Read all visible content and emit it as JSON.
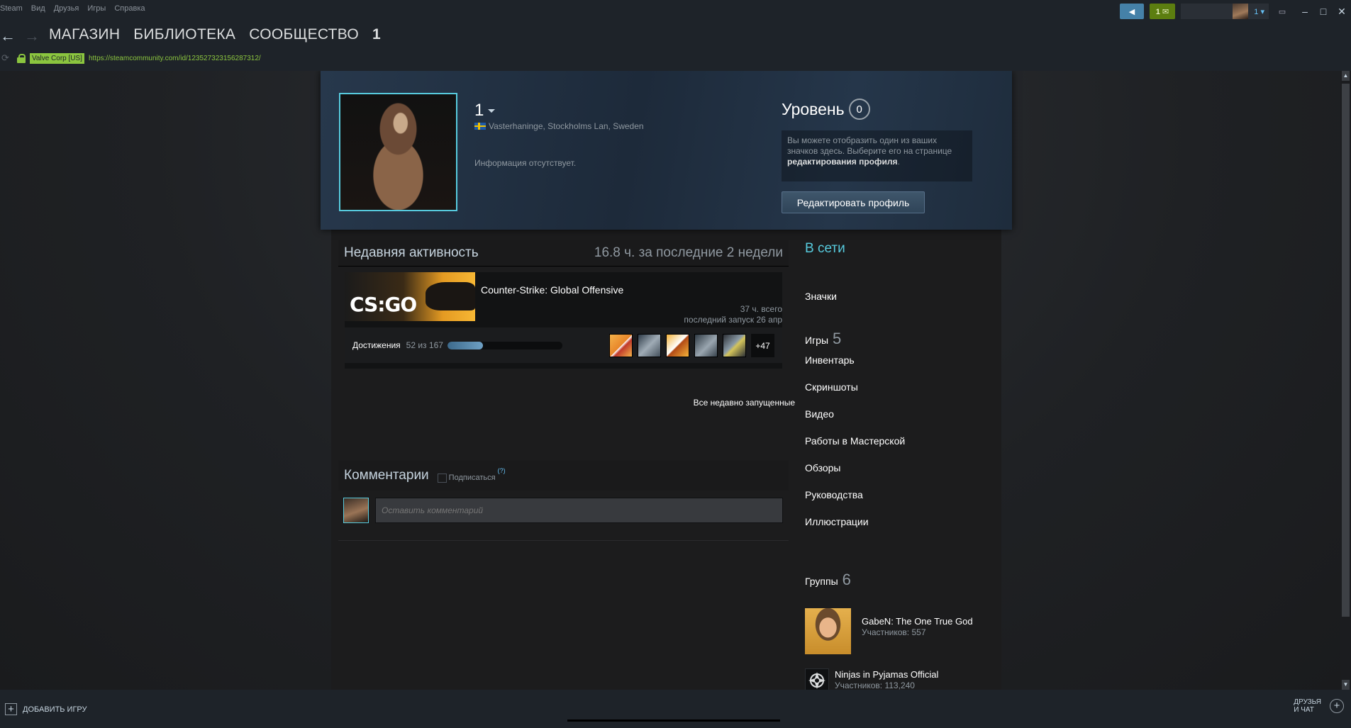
{
  "menu": [
    "Steam",
    "Вид",
    "Друзья",
    "Игры",
    "Справка"
  ],
  "tray": {
    "inbox_count": "1 ✉",
    "username": "1 ▾"
  },
  "nav": {
    "links": [
      "МАГАЗИН",
      "БИБЛИОТЕКА",
      "СООБЩЕСТВО",
      "1"
    ],
    "cert": "Valve Corp [US]",
    "url": "https://steamcommunity.com/id/123527323156287312/"
  },
  "profile": {
    "persona": "1",
    "location": "Vasterhaninge, Stockholms Lan, Sweden",
    "summary": "Информация отсутствует.",
    "level_label": "Уровень",
    "level": "0",
    "badge_hint_pre": "Вы можете отобразить один из ваших значков здесь. Выберите его на странице ",
    "badge_hint_link": "редактирования профиля",
    "badge_hint_post": ".",
    "edit_button": "Редактировать профиль"
  },
  "activity": {
    "title": "Недавняя активность",
    "hours_summary": "16.8 ч. за последние 2 недели",
    "game": {
      "name": "Counter-Strike: Global Offensive",
      "logo": "CS:GO",
      "total": "37 ч. всего",
      "last_played": "последний запуск 26 апр"
    },
    "achievements": {
      "label": "Достижения",
      "count": "52 из 167",
      "progress": 0.311,
      "more": "+47"
    },
    "all_recent": "Все недавно запущенные"
  },
  "comments": {
    "title": "Комментарии",
    "subscribe": "Подписаться",
    "help": "(?)",
    "placeholder": "Оставить комментарий"
  },
  "sidebar": {
    "status": "В сети",
    "badges": "Значки",
    "games_label": "Игры",
    "games_count": "5",
    "links": [
      "Инвентарь",
      "Скриншоты",
      "Видео",
      "Работы в Мастерской",
      "Обзоры",
      "Руководства",
      "Иллюстрации"
    ],
    "groups_label": "Группы",
    "groups_count": "6",
    "groups": [
      {
        "name": "GabeN: The One True God",
        "members": "Участников: 557"
      },
      {
        "name": "Ninjas in Pyjamas Official",
        "members": "Участников: 113,240"
      }
    ]
  },
  "bottom": {
    "add_game": "ДОБАВИТЬ ИГРУ",
    "friends_line1": "ДРУЗЬЯ",
    "friends_line2": "И ЧАТ"
  },
  "colors": {
    "accent": "#66c0f4",
    "online": "#57cbde",
    "secure": "#8bc53f",
    "inbox": "#5c7e10"
  }
}
